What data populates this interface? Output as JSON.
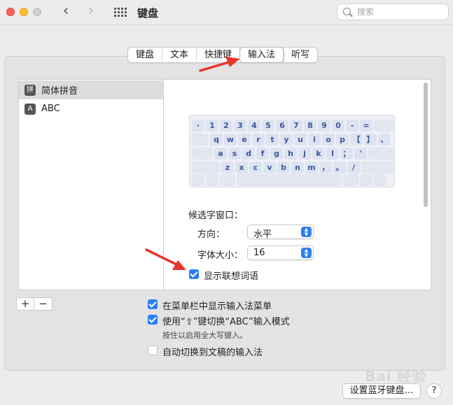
{
  "window": {
    "title": "键盘",
    "search_placeholder": "搜索",
    "traffic_colors": {
      "close": "#fe5f57",
      "minimize": "#febc2e",
      "maximize": "#cfcfcf"
    }
  },
  "tabs": [
    {
      "label": "键盘",
      "active": false
    },
    {
      "label": "文本",
      "active": false
    },
    {
      "label": "快捷键",
      "active": false
    },
    {
      "label": "输入法",
      "active": true
    },
    {
      "label": "听写",
      "active": false
    }
  ],
  "input_sources": [
    {
      "icon_glyph": "拼",
      "label": "简体拼音",
      "selected": true
    },
    {
      "icon_glyph": "A",
      "label": "ABC",
      "selected": false
    }
  ],
  "keyboard_preview": {
    "row1": [
      "·",
      "1",
      "2",
      "3",
      "4",
      "5",
      "6",
      "7",
      "8",
      "9",
      "0",
      "-",
      "="
    ],
    "row2": [
      "q",
      "w",
      "e",
      "r",
      "t",
      "y",
      "u",
      "i",
      "o",
      "p",
      "【",
      "】",
      "、"
    ],
    "row3": [
      "a",
      "s",
      "d",
      "f",
      "g",
      "h",
      "j",
      "k",
      "l",
      "；",
      "'"
    ],
    "row4": [
      "z",
      "x",
      "c",
      "v",
      "b",
      "n",
      "m",
      "，",
      "。",
      "/"
    ]
  },
  "candidate_window": {
    "section_label": "候选字窗口：",
    "orientation_label": "方向：",
    "orientation_value": "水平",
    "font_size_label": "字体大小：",
    "font_size_value": "16"
  },
  "checkboxes": {
    "show_predictions": {
      "label": "显示联想词语",
      "checked": true
    },
    "show_menu_bar": {
      "label": "在菜单栏中显示输入法菜单",
      "checked": true
    },
    "caps_lock_switch": {
      "label": "使用“⇪”键切换“ABC”输入模式",
      "checked": true
    },
    "caps_lock_hint": "按住以启用全大写键入。",
    "auto_switch": {
      "label": "自动切换到文稿的输入法",
      "checked": false
    }
  },
  "list_controls": {
    "add": "+",
    "remove": "−"
  },
  "bottom": {
    "bluetooth_button": "设置蓝牙键盘…",
    "help_button": "?"
  },
  "watermark": "Bai 经验",
  "accent_color": "#2a7ff3",
  "annotation_color": "#e8352b"
}
